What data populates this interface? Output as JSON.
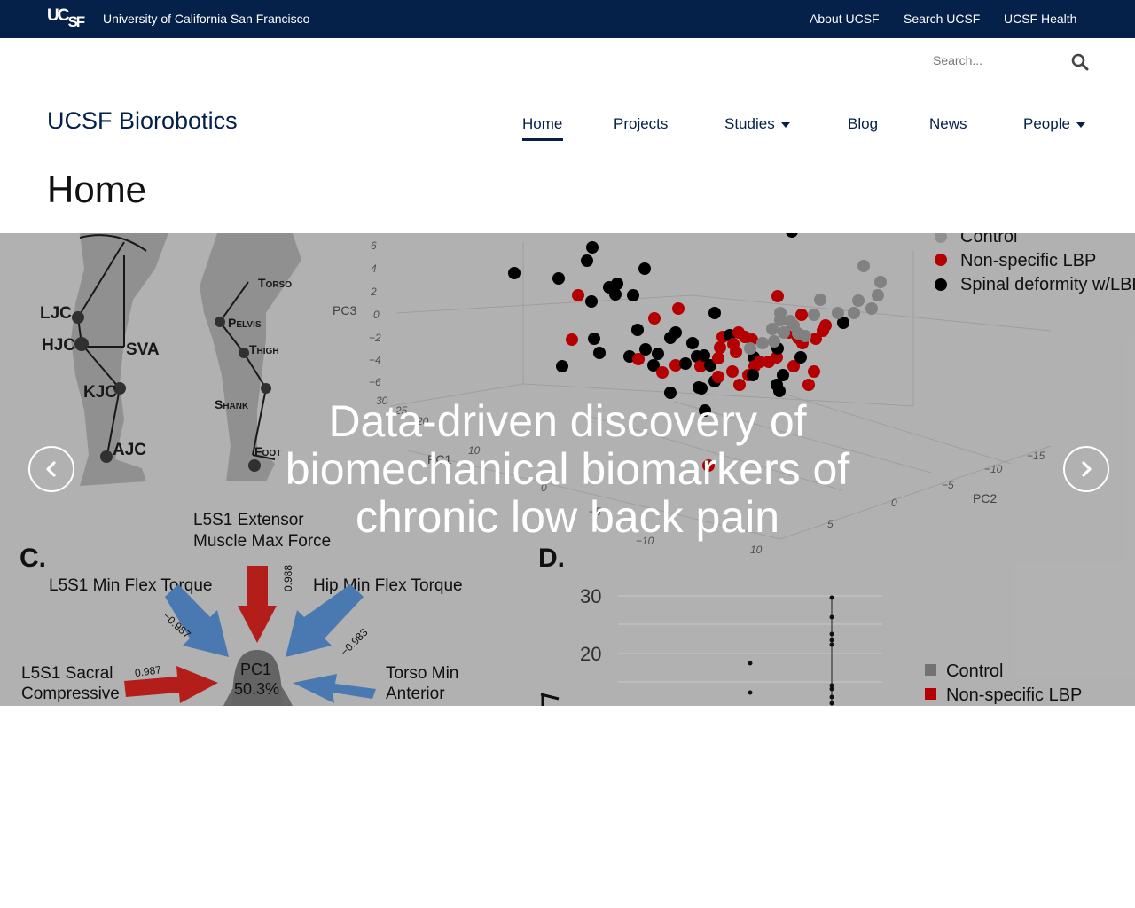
{
  "topbar": {
    "logo_main": "UC",
    "logo_sub": "SF",
    "university_name": "University of California San Francisco",
    "links": [
      {
        "label": "About UCSF"
      },
      {
        "label": "Search UCSF"
      },
      {
        "label": "UCSF Health"
      }
    ],
    "background_color": "#052049"
  },
  "search": {
    "placeholder": "Search...",
    "icon": "search-icon"
  },
  "site": {
    "title": "UCSF Biorobotics"
  },
  "nav": {
    "items": [
      {
        "label": "Home",
        "active": true
      },
      {
        "label": "Projects",
        "active": false
      },
      {
        "label": "Studies",
        "active": false,
        "dropdown": true
      },
      {
        "label": "Blog",
        "active": false
      },
      {
        "label": "News",
        "active": false
      },
      {
        "label": "People",
        "active": false,
        "dropdown": true
      }
    ]
  },
  "page": {
    "title": "Home"
  },
  "carousel": {
    "caption": "Data-driven discovery of biomechanical biomarkers of chronic low back pain",
    "prev_icon": "chevron-left-icon",
    "next_icon": "chevron-right-icon",
    "figure": {
      "joint_labels": [
        "LJC",
        "HJC",
        "SVA",
        "KJC",
        "AJC"
      ],
      "segment_labels": [
        "Torso",
        "Pelvis",
        "Thigh",
        "Shank",
        "Foot"
      ],
      "pc3_axis": "PC3",
      "pc3_ticks": [
        "6",
        "4",
        "2",
        "0",
        "−2",
        "−4",
        "−6"
      ],
      "pc1_label": "PC1",
      "pc1_ticks": [
        "30",
        "25",
        "20",
        "10",
        "0",
        "−5",
        "−10"
      ],
      "pc2_label": "PC2",
      "pc2_ticks": [
        "−15",
        "−10",
        "−5",
        "0",
        "5",
        "10"
      ],
      "legend_top": [
        "Control",
        "Non-specific LBP",
        "Spinal deformity w/LBP"
      ],
      "panel_c": "C.",
      "panel_d": "D.",
      "radar": {
        "center_label": "PC1",
        "center_value": "50.3%",
        "labels": [
          "L5S1 Extensor",
          "Muscle Max Force",
          "L5S1 Min Flex Torque",
          "Hip Min Flex Torque",
          "L5S1 Sacral",
          "Compressive",
          "Torso Min",
          "Anterior"
        ],
        "loadings": [
          "0.988",
          "−0.987",
          "−0.983",
          "0.987"
        ]
      },
      "panel_d_ticks": [
        "30",
        "20"
      ],
      "legend_bottom": [
        "Control",
        "Non-specific LBP"
      ],
      "colors": {
        "control": "#8a8a8a",
        "lbp": "#c00000",
        "deformity": "#000000",
        "arrow_blue": "#4f81bd",
        "arrow_red": "#c0201c"
      }
    }
  }
}
